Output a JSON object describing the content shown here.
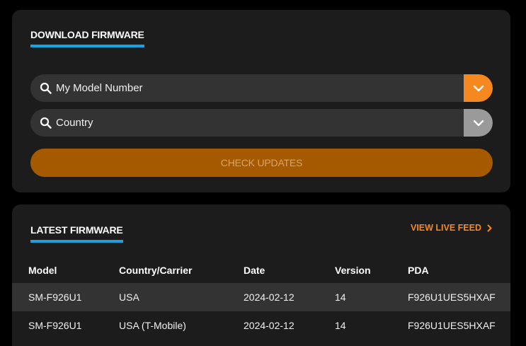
{
  "download": {
    "title": "DOWNLOAD FIRMWARE",
    "model_placeholder": "My Model Number",
    "country_placeholder": "Country",
    "check_button": "CHECK UPDATES"
  },
  "latest": {
    "title": "LATEST FIRMWARE",
    "live_feed": "VIEW LIVE FEED",
    "columns": [
      "Model",
      "Country/Carrier",
      "Date",
      "Version",
      "PDA"
    ],
    "rows": [
      {
        "model": "SM-F926U1",
        "country": "USA",
        "date": "2024-02-12",
        "version": "14",
        "pda": "F926U1UES5HXAF"
      },
      {
        "model": "SM-F926U1",
        "country": "USA (T-Mobile)",
        "date": "2024-02-12",
        "version": "14",
        "pda": "F926U1UES5HXAF"
      }
    ]
  },
  "colors": {
    "accent_blue": "#1ba1e2",
    "accent_orange": "#f5891f",
    "button_disabled": "#a65a00"
  },
  "icons": [
    "search-icon",
    "chevron-down-icon",
    "chevron-right-icon"
  ]
}
